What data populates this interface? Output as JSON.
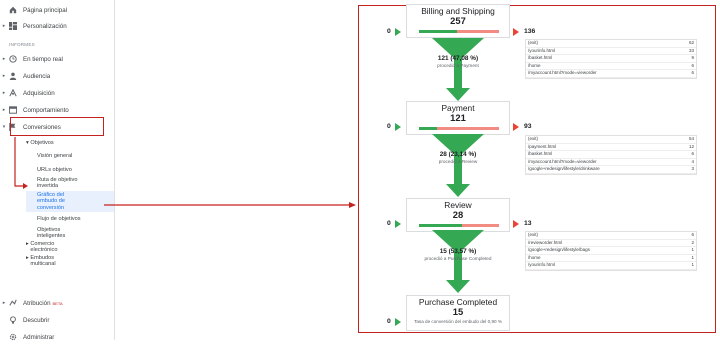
{
  "sidebar": {
    "home": "Página principal",
    "customization": "Personalización",
    "reports_label": "INFORMES",
    "realtime": "En tiempo real",
    "audience": "Audiencia",
    "acquisition": "Adquisición",
    "behavior": "Comportamiento",
    "conversions": "Conversiones",
    "goals": "Objetivos",
    "overview": "Visión general",
    "goal_urls": "URLs objetivo",
    "reverse_path": "Ruta de objetivo invertida",
    "funnel_viz": "Gráfico del embudo de conversión",
    "goal_flow": "Flujo de objetivos",
    "smart_goals": "Objetivos inteligentes",
    "ecommerce": "Comercio electrónico",
    "multichannel": "Embudos multicanal",
    "attribution": "Atribución",
    "beta": "BETA",
    "discover": "Descubrir",
    "admin": "Administrar"
  },
  "funnel": {
    "steps": [
      {
        "name": "Billing and Shipping",
        "count": "257",
        "entries": "0",
        "exits": "136",
        "fill": 0.47
      },
      {
        "name": "Payment",
        "count": "121",
        "entries": "0",
        "exits": "93",
        "fill": 0.23
      },
      {
        "name": "Review",
        "count": "28",
        "entries": "0",
        "exits": "13",
        "fill": 0.54
      },
      {
        "name": "Purchase Completed",
        "count": "15",
        "entries": "0",
        "fill": 1.0
      }
    ],
    "transitions": [
      {
        "value": "121 (47,08 %)",
        "label": "procedió a Payment"
      },
      {
        "value": "28 (23,14 %)",
        "label": "procedió a Review"
      },
      {
        "value": "15 (53,57 %)",
        "label": "procedió a Purchase Completed"
      }
    ],
    "conversion_rate": "Tasa de conversión del embudo del 0,90 %",
    "exit_tables": [
      [
        {
          "page": "(exit)",
          "count": "62"
        },
        {
          "page": "/yourinfo.html",
          "count": "33"
        },
        {
          "page": "/basket.html",
          "count": "9"
        },
        {
          "page": "/home",
          "count": "6"
        },
        {
          "page": "/myaccount.html?mode=vieworder",
          "count": "6"
        }
      ],
      [
        {
          "page": "(exit)",
          "count": "54"
        },
        {
          "page": "/payment.html",
          "count": "12"
        },
        {
          "page": "/basket.html",
          "count": "6"
        },
        {
          "page": "/myaccount.html?mode=vieworder",
          "count": "4"
        },
        {
          "page": "/google+redesign/lifestyle/drinkware",
          "count": "3"
        }
      ],
      [
        {
          "page": "(exit)",
          "count": "6"
        },
        {
          "page": "/revieworder.html",
          "count": "2"
        },
        {
          "page": "/google+redesign/lifestyle/bags",
          "count": "1"
        },
        {
          "page": "/home",
          "count": "1"
        },
        {
          "page": "/yourinfo.html",
          "count": "1"
        }
      ]
    ]
  },
  "colors": {
    "green": "#34a853",
    "red": "#ea4335",
    "accent": "#1a73e8",
    "highlight": "#c5221f"
  }
}
